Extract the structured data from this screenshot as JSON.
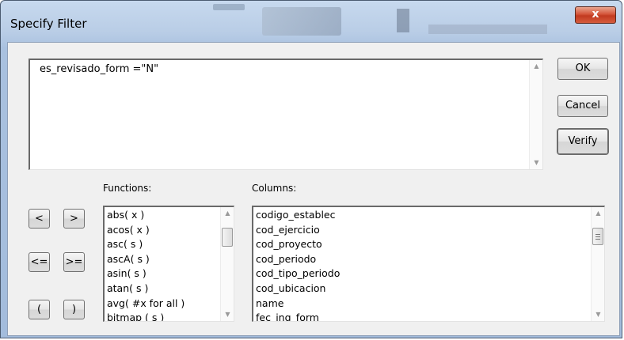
{
  "window": {
    "title": "Specify Filter",
    "close_glyph": "x"
  },
  "expression": {
    "value": "es_revisado_form =\"N\""
  },
  "buttons": {
    "ok": "OK",
    "cancel": "Cancel",
    "verify": "Verify"
  },
  "operators": {
    "lt": "<",
    "gt": ">",
    "le": "<=",
    "ge": ">=",
    "lparen": "(",
    "rparen": ")"
  },
  "functions": {
    "label": "Functions:",
    "items": [
      "abs( x )",
      "acos( x )",
      "asc( s )",
      "ascA( s )",
      "asin( s )",
      "atan( s )",
      "avg( #x for all )",
      "bitmap ( s )"
    ]
  },
  "columns": {
    "label": "Columns:",
    "items": [
      "codigo_establec",
      "cod_ejercicio",
      "cod_proyecto",
      "cod_periodo",
      "cod_tipo_periodo",
      "cod_ubicacion",
      "name",
      "fec_ing_form"
    ]
  },
  "icons": {
    "scroll_up": "up-arrow-icon",
    "scroll_down": "down-arrow-icon",
    "close": "close-icon"
  }
}
